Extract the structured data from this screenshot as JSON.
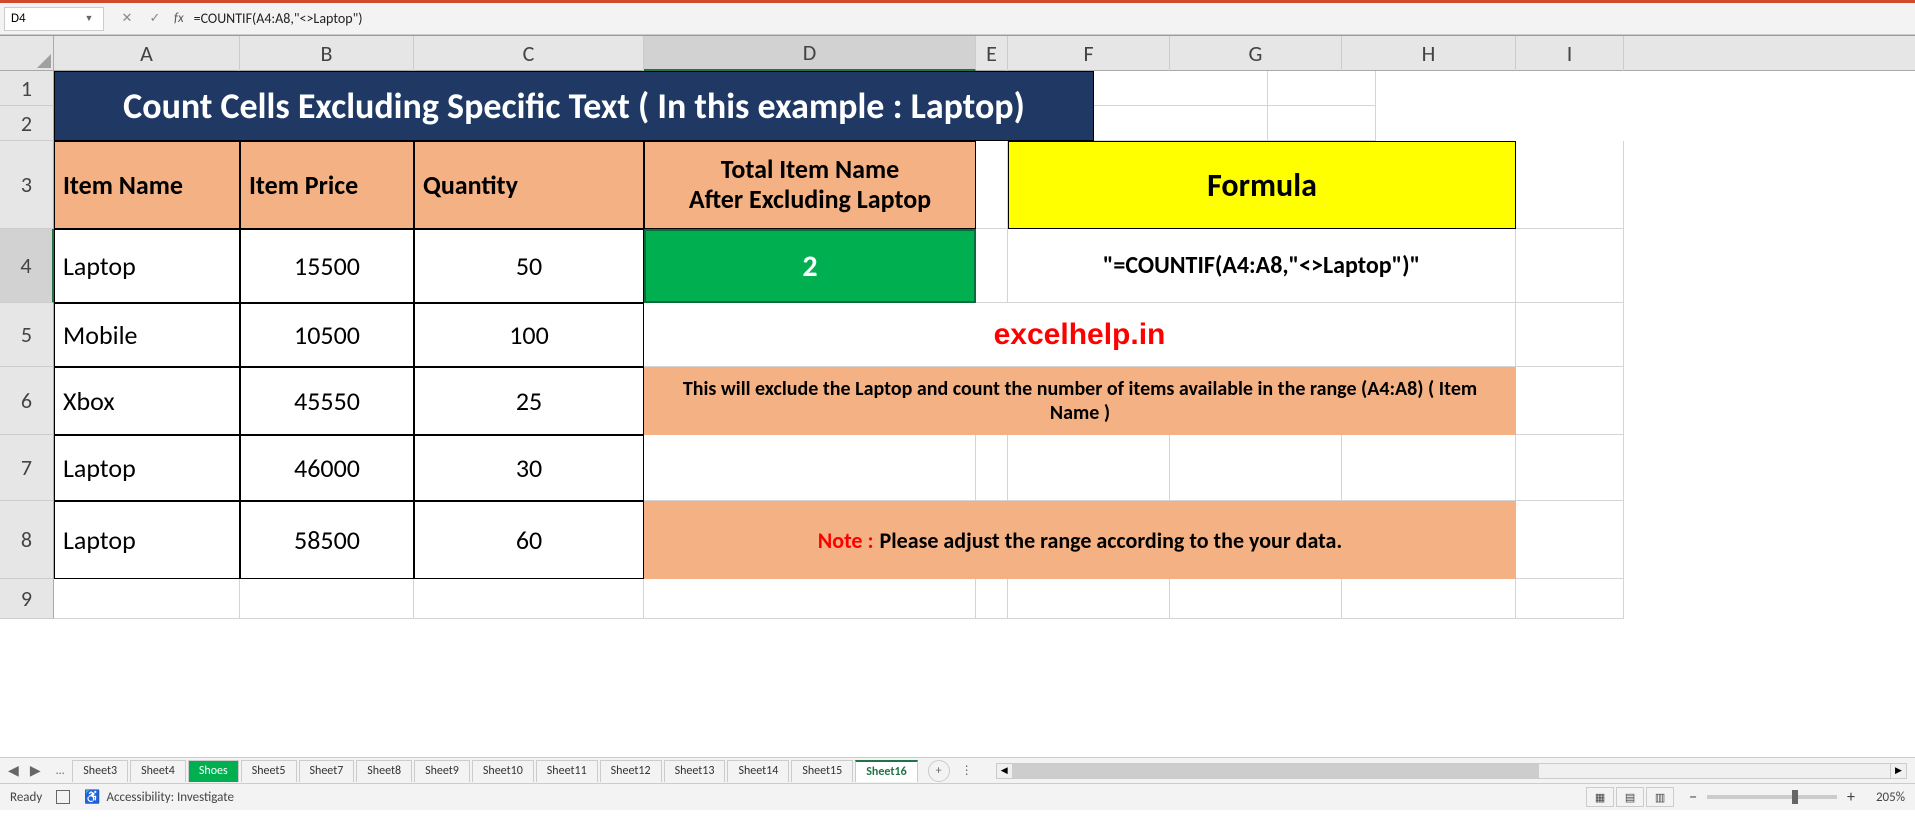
{
  "name_box": "D4",
  "formula": "=COUNTIF(A4:A8,\"<>Laptop\")",
  "columns": [
    "A",
    "B",
    "C",
    "D",
    "E",
    "F",
    "G",
    "H",
    "I"
  ],
  "col_widths": {
    "A": 186,
    "B": 174,
    "C": 230,
    "D": 332,
    "E": 32,
    "F": 162,
    "G": 172,
    "H": 174,
    "I": 108
  },
  "selected_col": "D",
  "selected_row": 4,
  "title": "Count Cells Excluding Specific Text ( In this example : Laptop)",
  "headers": {
    "A": "Item Name",
    "B": "Item Price",
    "C": "Quantity",
    "D_line1": "Total Item Name",
    "D_line2": "After Excluding Laptop",
    "formula": "Formula"
  },
  "data_rows": [
    {
      "item": "Laptop",
      "price": "15500",
      "qty": "50"
    },
    {
      "item": "Mobile",
      "price": "10500",
      "qty": "100"
    },
    {
      "item": "Xbox",
      "price": "45550",
      "qty": "25"
    },
    {
      "item": "Laptop",
      "price": "46000",
      "qty": "30"
    },
    {
      "item": "Laptop",
      "price": "58500",
      "qty": "60"
    }
  ],
  "result": "2",
  "formula_display": "\"=COUNTIF(A4:A8,\"<>Laptop\")\"",
  "watermark": "excelhelp.in",
  "note1": "This will exclude the Laptop and count the number of items available in the range (A4:A8) ( Item Name )",
  "note2_prefix": "Note : ",
  "note2_text": "Please adjust the range according to the your data.",
  "tabs": [
    "Sheet3",
    "Sheet4",
    "Shoes",
    "Sheet5",
    "Sheet7",
    "Sheet8",
    "Sheet9",
    "Sheet10",
    "Sheet11",
    "Sheet12",
    "Sheet13",
    "Sheet14",
    "Sheet15",
    "Sheet16"
  ],
  "active_tab": "Sheet16",
  "green_tab": "Shoes",
  "status": {
    "ready": "Ready",
    "access": "Accessibility: Investigate",
    "zoom": "205%"
  }
}
